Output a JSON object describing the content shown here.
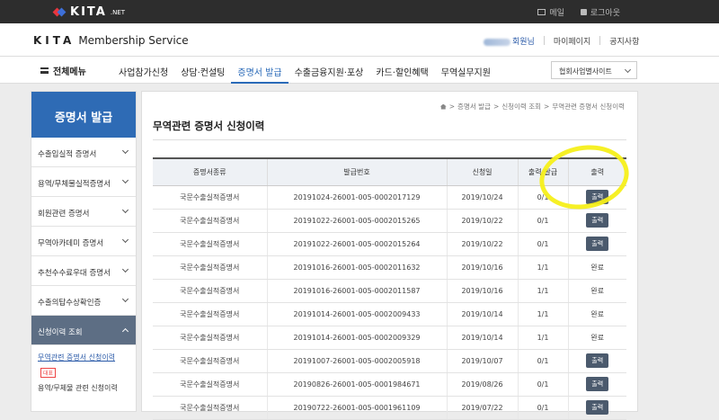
{
  "topbar": {
    "logo_text": "KITA",
    "logo_suffix": ".NET",
    "links": [
      {
        "label": "메일",
        "icon": "mail-icon"
      },
      {
        "label": "로그아웃",
        "icon": "lock-icon"
      }
    ]
  },
  "membar": {
    "brand_main": "KITA",
    "brand_sub": "Membership Service",
    "user_suffix": "회원님",
    "mypage": "마이페이지",
    "notice": "공지사항"
  },
  "nav": {
    "all_menu": "전체메뉴",
    "items": [
      "사업참가신청",
      "상담·컨설팅",
      "증명서 발급",
      "수출금융지원·포상",
      "카드·할인혜택",
      "무역실무지원"
    ],
    "active_index": 2,
    "site_select": "협회사업별사이트"
  },
  "sidebar": {
    "title": "증명서 발급",
    "items": [
      "수출입실적 증명서",
      "용역/무체물실적증명서",
      "회원관련 증명서",
      "무역아카데미 증명서",
      "추천수수료우대 증명서",
      "수출의탑수상확인증",
      "신청이력 조회"
    ],
    "sub_items": [
      "무역관련 증명서 신청이력",
      "용역/무체물 관련 신청이력"
    ],
    "badge": "대표"
  },
  "main": {
    "breadcrumb": [
      "증명서 발급",
      "신청이력 조회",
      "무역관련 증명서 신청이력"
    ],
    "title": "무역관련 증명서 신청이력",
    "table": {
      "headers": [
        "증명서종류",
        "발급번호",
        "신청일",
        "출력/발급",
        "출력"
      ],
      "rows": [
        {
          "type": "국문수출실적증명서",
          "number": "20191024-26001-005-0002017129",
          "date": "2019/10/24",
          "count": "0/1",
          "action": "출력",
          "button": true
        },
        {
          "type": "국문수출실적증명서",
          "number": "20191022-26001-005-0002015265",
          "date": "2019/10/22",
          "count": "0/1",
          "action": "출력",
          "button": true
        },
        {
          "type": "국문수출실적증명서",
          "number": "20191022-26001-005-0002015264",
          "date": "2019/10/22",
          "count": "0/1",
          "action": "출력",
          "button": true
        },
        {
          "type": "국문수출실적증명서",
          "number": "20191016-26001-005-0002011632",
          "date": "2019/10/16",
          "count": "1/1",
          "action": "완료",
          "button": false
        },
        {
          "type": "국문수출실적증명서",
          "number": "20191016-26001-005-0002011587",
          "date": "2019/10/16",
          "count": "1/1",
          "action": "완료",
          "button": false
        },
        {
          "type": "국문수출실적증명서",
          "number": "20191014-26001-005-0002009433",
          "date": "2019/10/14",
          "count": "1/1",
          "action": "완료",
          "button": false
        },
        {
          "type": "국문수출실적증명서",
          "number": "20191014-26001-005-0002009329",
          "date": "2019/10/14",
          "count": "1/1",
          "action": "완료",
          "button": false
        },
        {
          "type": "국문수출실적증명서",
          "number": "20191007-26001-005-0002005918",
          "date": "2019/10/07",
          "count": "0/1",
          "action": "출력",
          "button": true
        },
        {
          "type": "국문수출실적증명서",
          "number": "20190826-26001-005-0001984671",
          "date": "2019/08/26",
          "count": "0/1",
          "action": "출력",
          "button": true
        },
        {
          "type": "국문수출실적증명서",
          "number": "20190722-26001-005-0001961109",
          "date": "2019/07/22",
          "count": "0/1",
          "action": "출력",
          "button": true
        }
      ]
    }
  },
  "colors": {
    "accent": "#2e6bb5",
    "highlight": "#f6ef1a",
    "button": "#4b5a6d"
  }
}
